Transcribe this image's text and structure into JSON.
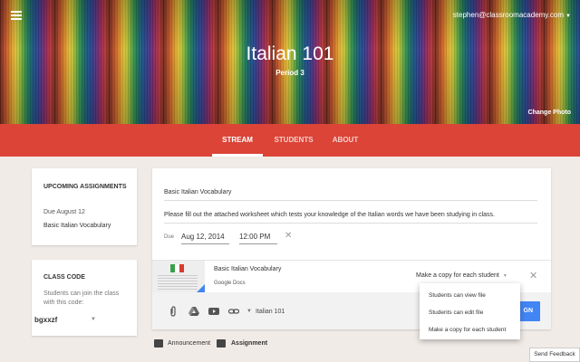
{
  "header": {
    "user_email": "stephen@classroomacademy.com",
    "class_title": "Italian 101",
    "class_period": "Period 3",
    "change_photo_label": "Change Photo"
  },
  "nav": {
    "tabs": [
      {
        "label": "STREAM",
        "active": true
      },
      {
        "label": "STUDENTS",
        "active": false
      },
      {
        "label": "ABOUT",
        "active": false
      }
    ]
  },
  "upcoming": {
    "heading": "UPCOMING ASSIGNMENTS",
    "due_text": "Due August 12",
    "assignment_link": "Basic Italian Vocabulary"
  },
  "class_code": {
    "heading": "CLASS CODE",
    "helper_text_line1": "Students can join the class",
    "helper_text_line2": "with this code:",
    "code": "bgxxzf"
  },
  "composer": {
    "title_value": "Basic Italian Vocabulary",
    "description_value": "Please fill out the attached worksheet which tests your knowledge of the Italian words we have been studying in class.",
    "due_label": "Due",
    "due_date": "Aug 12, 2014",
    "due_time": "12:00 PM",
    "attachment": {
      "name": "Basic Italian Vocabulary",
      "type": "Google Docs",
      "share_option": "Make a copy for each student"
    },
    "toolbar": {
      "target_class": "Italian 101",
      "assign_label": "GN"
    }
  },
  "share_menu": {
    "options": [
      "Students can view file",
      "Students can edit file",
      "Make a copy for each student"
    ]
  },
  "post_types": {
    "announcement": "Announcement",
    "assignment": "Assignment"
  },
  "footer": {
    "send_feedback": "Send Feedback"
  },
  "colors": {
    "nav_red": "#db4437",
    "assign_blue": "#4285f4",
    "page_bg": "#f1ebe7"
  }
}
